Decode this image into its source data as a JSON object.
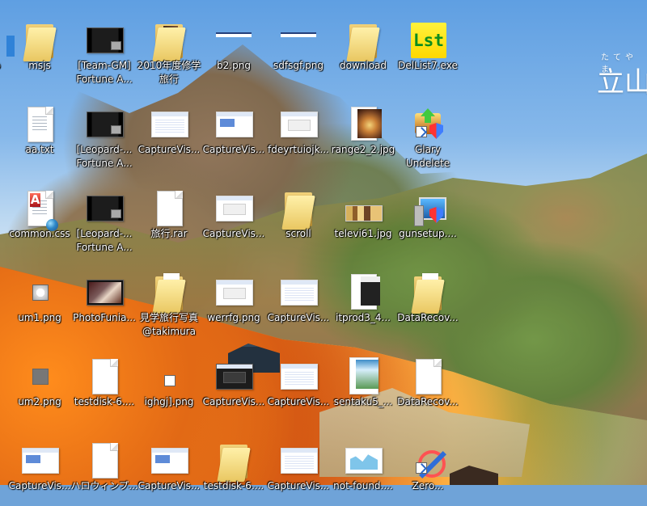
{
  "wallpaper": {
    "watermark_furigana": "たてやま",
    "watermark_title": "立山"
  },
  "desktop": {
    "icons": [
      {
        "label": "p",
        "icon": "partial-icon",
        "kind": "partial"
      },
      {
        "label": "msjs",
        "icon": "folder-icon",
        "kind": "folder"
      },
      {
        "label": "[Team-GM]\nFortune A...",
        "icon": "video-file-icon",
        "kind": "video"
      },
      {
        "label": "2010年度修学\n旅行",
        "icon": "photo-folder-icon",
        "kind": "photo-folder"
      },
      {
        "label": "b2.png",
        "icon": "png-thumbnail-icon",
        "kind": "thin-bar"
      },
      {
        "label": "sdfsgf.png",
        "icon": "png-thumbnail-icon",
        "kind": "thin-bar"
      },
      {
        "label": "download",
        "icon": "folder-icon",
        "kind": "folder"
      },
      {
        "label": "DelList7.exe",
        "icon": "dellist-app-icon",
        "kind": "lst"
      },
      {
        "label": "aa.txt",
        "icon": "text-file-icon",
        "kind": "text"
      },
      {
        "label": "[Leopard-...\nFortune A...",
        "icon": "video-file-icon",
        "kind": "video"
      },
      {
        "label": "CaptureVis...",
        "icon": "screenshot-thumbnail-icon",
        "kind": "capture-grid"
      },
      {
        "label": "CaptureVis...",
        "icon": "screenshot-thumbnail-icon",
        "kind": "capture-blue"
      },
      {
        "label": "fdeyrtuiojk...",
        "icon": "screenshot-thumbnail-icon",
        "kind": "capture-tiny"
      },
      {
        "label": "range2_2.jpg",
        "icon": "photo-thumbnail-icon",
        "kind": "food"
      },
      {
        "label": "Glary\nUndelete",
        "icon": "glary-undelete-icon",
        "kind": "glary"
      },
      {
        "label": "common.css",
        "icon": "css-file-icon",
        "kind": "css"
      },
      {
        "label": "[Leopard-...\nFortune A...",
        "icon": "video-file-icon",
        "kind": "video"
      },
      {
        "label": "旅行.rar",
        "icon": "archive-file-icon",
        "kind": "blank"
      },
      {
        "label": "CaptureVis...",
        "icon": "screenshot-thumbnail-icon",
        "kind": "capture-plain"
      },
      {
        "label": "scroll",
        "icon": "folder-icon",
        "kind": "folder"
      },
      {
        "label": "televi61.jpg",
        "icon": "photo-thumbnail-icon",
        "kind": "tv"
      },
      {
        "label": "gunsetup....",
        "icon": "setup-app-icon",
        "kind": "setup"
      },
      {
        "label": "um1.png",
        "icon": "png-thumbnail-icon",
        "kind": "small-orb"
      },
      {
        "label": "PhotoFunia...",
        "icon": "photo-thumbnail-icon",
        "kind": "photo"
      },
      {
        "label": "見学旅行写真\n@takimura",
        "icon": "folder-icon",
        "kind": "folder-paper"
      },
      {
        "label": "werrfg.png",
        "icon": "png-thumbnail-icon",
        "kind": "capture-plain"
      },
      {
        "label": "CaptureVis...",
        "icon": "screenshot-thumbnail-icon",
        "kind": "capture-grid"
      },
      {
        "label": "itprod3_4...",
        "icon": "photo-thumbnail-icon",
        "kind": "person"
      },
      {
        "label": "DataRecov...",
        "icon": "folder-icon",
        "kind": "folder-paper"
      },
      {
        "label": "um2.png",
        "icon": "png-thumbnail-icon",
        "kind": "small-gray"
      },
      {
        "label": "testdisk-6....",
        "icon": "document-file-icon",
        "kind": "blank"
      },
      {
        "label": "ighgj].png",
        "icon": "png-thumbnail-icon",
        "kind": "small-box"
      },
      {
        "label": "CaptureVis...",
        "icon": "screenshot-thumbnail-icon",
        "kind": "dark-window"
      },
      {
        "label": "CaptureVis...",
        "icon": "screenshot-thumbnail-icon",
        "kind": "capture-grid"
      },
      {
        "label": "sentaku5_...",
        "icon": "photo-thumbnail-icon",
        "kind": "book"
      },
      {
        "label": "DataRecov...",
        "icon": "document-file-icon",
        "kind": "blank"
      },
      {
        "label": "CaptureVis...",
        "icon": "screenshot-thumbnail-icon",
        "kind": "capture-blue"
      },
      {
        "label": "ハロウィンプ...",
        "icon": "document-file-icon",
        "kind": "blank"
      },
      {
        "label": "CaptureVis...",
        "icon": "screenshot-thumbnail-icon",
        "kind": "capture-blue"
      },
      {
        "label": "testdisk-6....",
        "icon": "folder-icon",
        "kind": "folder"
      },
      {
        "label": "CaptureVis...",
        "icon": "screenshot-thumbnail-icon",
        "kind": "capture-grid"
      },
      {
        "label": "not-found....",
        "icon": "photo-thumbnail-icon",
        "kind": "not-found"
      },
      {
        "label": "Zero...",
        "icon": "zero-app-icon",
        "kind": "zero"
      }
    ]
  }
}
